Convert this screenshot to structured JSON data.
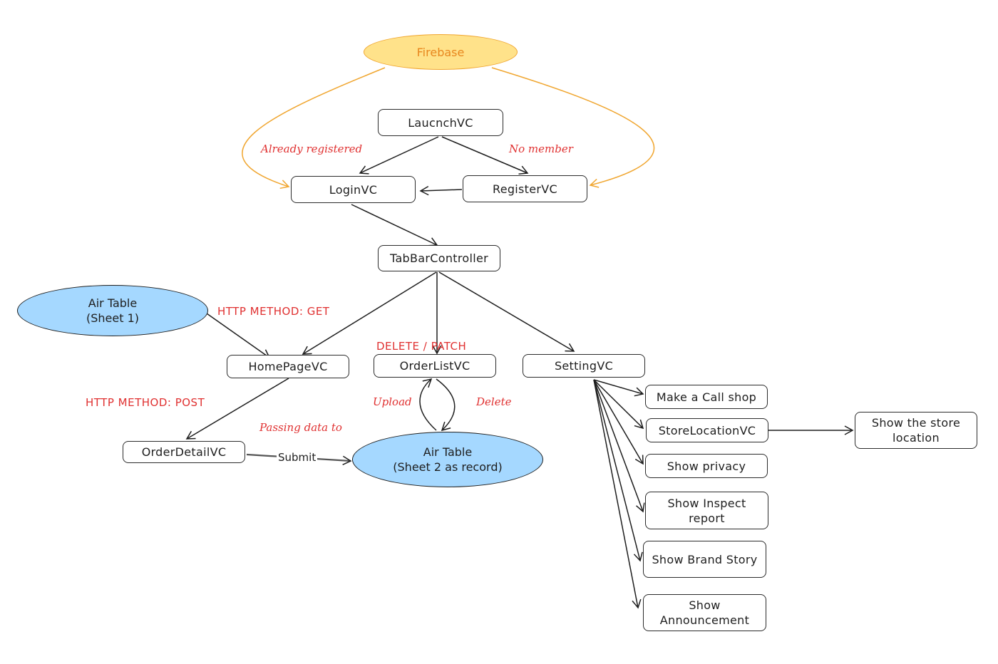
{
  "nodes": {
    "firebase": "Firebase",
    "launch": "LaucnchVC",
    "login": "LoginVC",
    "register": "RegisterVC",
    "tabbar": "TabBarController",
    "airtable1": [
      "Air Table",
      "(Sheet 1)"
    ],
    "homepage": "HomePageVC",
    "orderlist": "OrderListVC",
    "setting": "SettingVC",
    "orderdetail": "OrderDetailVC",
    "airtable2": [
      "Air Table",
      "(Sheet 2 as record)"
    ],
    "call": "Make a Call shop",
    "storelocation": "StoreLocationVC",
    "showstore": [
      "Show the store",
      "location"
    ],
    "privacy": "Show privacy",
    "inspect": [
      "Show Inspect",
      "report"
    ],
    "brand": "Show Brand Story",
    "announce": [
      "Show",
      "Announcement"
    ]
  },
  "edge_labels": {
    "already": "Already registered",
    "nomember": "No member",
    "get": "HTTP METHOD: GET",
    "deletepatch": "DELETE / PATCH",
    "post": "HTTP METHOD: POST",
    "upload": "Upload",
    "delete": "Delete",
    "passing": "Passing data to",
    "submit": "Submit"
  },
  "colors": {
    "firebase_fill": "#ffe28a",
    "firebase_stroke": "#f0a630",
    "airtable_fill": "#a5d8ff",
    "edge_label": "#e03131",
    "stroke": "#1e1e1e"
  }
}
